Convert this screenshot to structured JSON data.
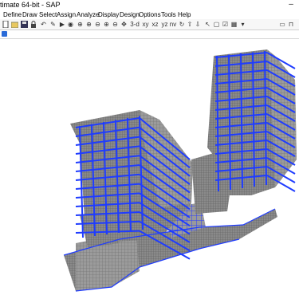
{
  "window": {
    "title": "timate 64-bit - SAP"
  },
  "menu": [
    "Define",
    "Draw",
    "Select",
    "Assign",
    "Analyze",
    "Display",
    "Design",
    "Options",
    "Tools",
    "Help"
  ],
  "toolbar": {
    "view_3d": "3-d",
    "view_xy": "xy",
    "view_xz": "xz",
    "view_yz": "yz",
    "view_nv": "nv"
  },
  "colors": {
    "frame": "#1f3cff",
    "mesh": "#7a7a7a",
    "background": "#ffffff"
  }
}
